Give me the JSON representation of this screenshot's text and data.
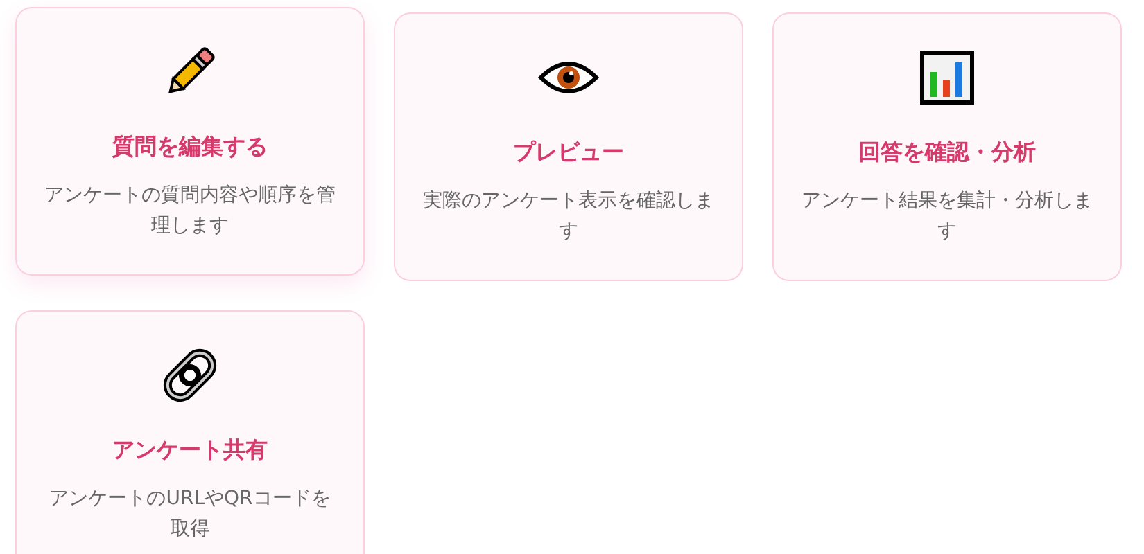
{
  "cards": [
    {
      "kind": "pencil",
      "title": "質問を編集する",
      "description": "アンケートの質問内容や順序を管理します",
      "hovered": true
    },
    {
      "kind": "eye",
      "title": "プレビュー",
      "description": "実際のアンケート表示を確認します",
      "hovered": false
    },
    {
      "kind": "chart",
      "title": "回答を確認・分析",
      "description": "アンケート結果を集計・分析します",
      "hovered": false
    },
    {
      "kind": "link",
      "title": "アンケート共有",
      "description": "アンケートのURLやQRコードを取得",
      "hovered": false
    }
  ]
}
